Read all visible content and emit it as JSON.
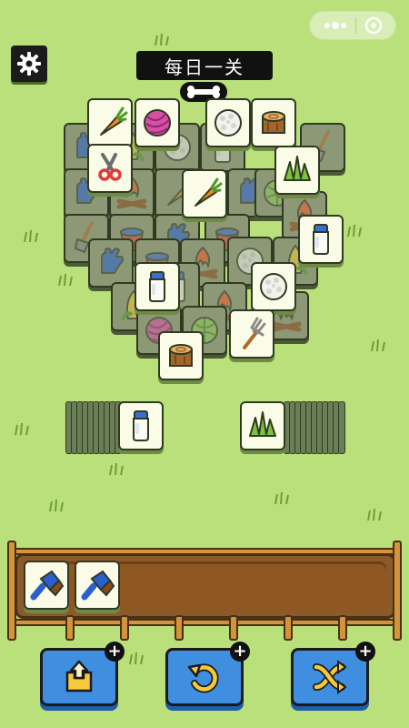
{
  "header": {
    "title": "每日一关"
  },
  "controls": {
    "settings_icon": "gear-icon",
    "capsule_menu_icon": "more-dots-icon",
    "capsule_close_icon": "target-close-icon"
  },
  "board": {
    "tile_types": [
      "carrot",
      "yarn-ball",
      "cotton",
      "tree-stump",
      "scissors",
      "grass",
      "glove",
      "bonfire",
      "milk-bottle",
      "corn",
      "cabbage",
      "pitchfork",
      "shovel",
      "bucket",
      "brush"
    ]
  },
  "side_stacks": {
    "left_top_tile": "milk-bottle",
    "right_top_tile": "grass"
  },
  "tray": {
    "slots": [
      "brush",
      "brush"
    ],
    "capacity": 7
  },
  "powerups": [
    {
      "name": "move-out",
      "icon": "move-out-icon"
    },
    {
      "name": "undo",
      "icon": "undo-icon"
    },
    {
      "name": "shuffle",
      "icon": "shuffle-icon"
    }
  ],
  "colors": {
    "background": "#b9e07a",
    "tile_face": "#fbfce8",
    "button": "#3f8ee0"
  }
}
